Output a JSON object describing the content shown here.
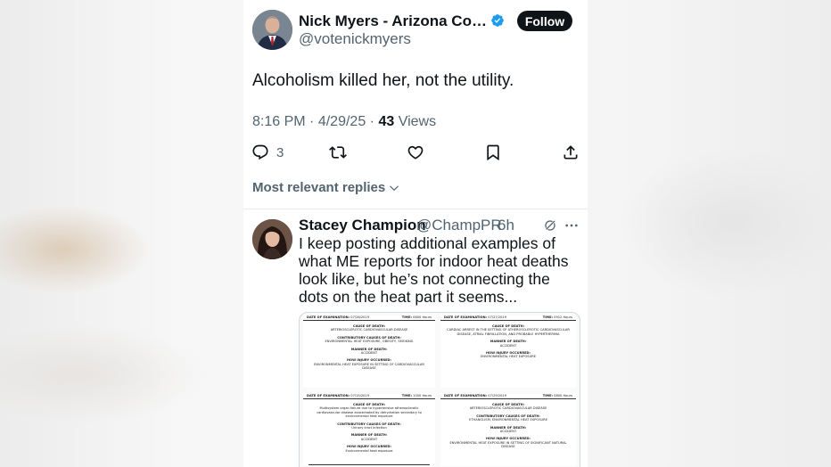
{
  "tweet": {
    "author_name": "Nick Myers - Arizona Corporation Commissioner",
    "handle": "@votenickmyers",
    "follow_label": "Follow",
    "text": "Alcoholism killed her, not the utility.",
    "time": "8:16 PM",
    "date": "4/29/25",
    "views_count": "43",
    "views_label": "Views",
    "reply_count": "3",
    "sep": "·"
  },
  "actions": [
    "reply-icon",
    "repost-icon",
    "like-icon",
    "bookmark-icon",
    "share-icon"
  ],
  "replies": {
    "sort_label": "Most relevant replies"
  },
  "reply": {
    "author_name": "Stacey Champion",
    "handle": "@ChampPR",
    "sep": "·",
    "time": "6h",
    "text": "I keep posting additional examples of what ME reports for indoor heat deaths look like, but he’s not connecting the dots on the heat part it seems..."
  },
  "doc_image": {
    "panels": [
      {
        "date_label": "DATE OF EXAMINATION:",
        "date": "07/26/2019",
        "time_label": "TIME:",
        "time": "0600 Hours",
        "cause_label": "CAUSE OF DEATH:",
        "cause": "ARTERIOSCLEROTIC CARDIOVASCULAR DISEASE",
        "contrib_label": "CONTRIBUTORY CAUSES OF DEATH:",
        "contrib": "ENVIRONMENTAL HEAT EXPOSURE, OBESITY, SMOKING",
        "manner_label": "MANNER OF DEATH:",
        "manner": "ACCIDENT",
        "how_label": "HOW INJURY OCCURRED:",
        "how": "ENVIRONMENTAL HEAT EXPOSURE IN SETTING OF CARDIOVASCULAR DISEASE"
      },
      {
        "date_label": "DATE OF EXAMINATION:",
        "date": "07/27/2019",
        "time_label": "TIME:",
        "time": "0912 Hours",
        "cause_label": "CAUSE OF DEATH:",
        "cause": "CARDIAC ARREST IN THE SETTING OF ATHEROSCLEROTIC CARDIOVASCULAR DISEASE, ATRIAL FIBRILLATION, AND PROBABLE HYPERTHERMIA",
        "contrib_label": "",
        "contrib": "",
        "manner_label": "MANNER OF DEATH:",
        "manner": "ACCIDENT",
        "how_label": "HOW INJURY OCCURRED:",
        "how": "ENVIRONMENTAL HEAT EXPOSURE"
      },
      {
        "date_label": "DATE OF EXAMINATION:",
        "date": "07/15/2019",
        "time_label": "TIME:",
        "time": "1050 Hours",
        "cause_label": "CAUSE OF DEATH:",
        "cause": "Multisystem organ failure due to hypertensive atherosclerotic cardiovascular disease exacerbated by dehydration secondary to environmental heat exposure",
        "contrib_label": "CONTRIBUTORY CAUSES OF DEATH:",
        "contrib": "Urinary tract infection",
        "manner_label": "MANNER OF DEATH:",
        "manner": "ACCIDENT",
        "how_label": "HOW INJURY OCCURRED:",
        "how": "Environmental heat exposure"
      },
      {
        "date_label": "DATE OF EXAMINATION:",
        "date": "07/29/2019",
        "time_label": "TIME:",
        "time": "0800 Hours",
        "cause_label": "CAUSE OF DEATH:",
        "cause": "ARTERIOSCLEROTIC CARDIOVASCULAR DISEASE",
        "contrib_label": "CONTRIBUTORY CAUSES OF DEATH:",
        "contrib": "ETHANOLISM, ENVIRONMENTAL HEAT EXPOSURE",
        "manner_label": "MANNER OF DEATH:",
        "manner": "ACCIDENT",
        "how_label": "HOW INJURY OCCURRED:",
        "how": "ENVIRONMENTAL HEAT EXPOSURE IN SETTING OF SIGNIFICANT NATURAL DISEASE"
      }
    ]
  },
  "colors": {
    "text_primary": "#0f1419",
    "text_secondary": "#536471",
    "verified_blue": "#1d9bf0",
    "follow_bg": "#0f1419"
  }
}
